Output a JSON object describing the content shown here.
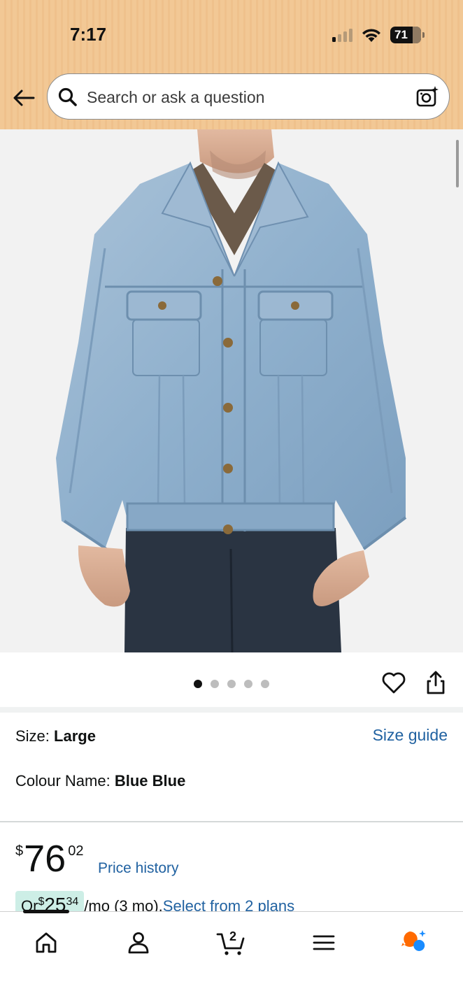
{
  "status_bar": {
    "time": "7:17",
    "battery": "71"
  },
  "search": {
    "placeholder": "Search or ask a question"
  },
  "product_image": {
    "alt": "Man wearing light blue denim trucker jacket over plaid shirt and dark jeans",
    "image_count": 5,
    "active_index": 0
  },
  "variations": {
    "size_label": "Size: ",
    "size_value": "Large",
    "size_guide": "Size guide",
    "colour_label": "Colour Name: ",
    "colour_value": "Blue Blue"
  },
  "price": {
    "symbol": "$",
    "whole": "76",
    "fraction": "02",
    "history_link": "Price history"
  },
  "installments": {
    "prefix": "Or ",
    "symbol": "$",
    "whole": "25",
    "fraction": "34",
    "term": "/mo (3 mo).",
    "link": "Select from 2 plans"
  },
  "bottom_nav": {
    "items": [
      "home",
      "account",
      "cart",
      "menu",
      "rufus"
    ],
    "cart_count": "2",
    "active": "home"
  },
  "colors": {
    "header_bg": "#f2c895",
    "link": "#2162a1",
    "badge_bg": "#cdeee6",
    "ai_orange": "#ff6a00",
    "ai_blue": "#1a8cff"
  }
}
